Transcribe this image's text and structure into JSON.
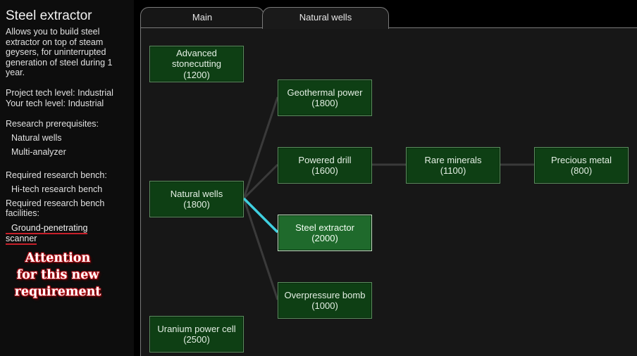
{
  "info": {
    "title": "Steel extractor",
    "description": "Allows you to build steel extractor on top of steam geysers, for uninterrupted generation of steel during 1 year.",
    "project_tech_level": "Project tech level: Industrial",
    "your_tech_level": "Your tech level: Industrial",
    "prereq_heading": "Research prerequisites:",
    "prerequisites": [
      "Natural wells",
      "Multi-analyzer"
    ],
    "bench_heading": "Required research bench:",
    "bench": "Hi-tech research bench",
    "facilities_heading_1": "Required research bench",
    "facilities_heading_2": "facilities:",
    "facility_line1": "Ground-penetrating",
    "facility_line2": "scanner"
  },
  "annotation": {
    "line1": "Attention",
    "line2": "for this new",
    "line3": "requirement",
    "color": "#c01018"
  },
  "tabs": [
    {
      "label": "Main"
    },
    {
      "label": "Natural wells"
    }
  ],
  "nodes": [
    {
      "name": "Advanced stonecutting",
      "cost": "(1200)"
    },
    {
      "name": "Geothermal power",
      "cost": "(1800)"
    },
    {
      "name": "Powered drill",
      "cost": "(1600)"
    },
    {
      "name": "Rare minerals",
      "cost": "(1100)"
    },
    {
      "name": "Precious metal",
      "cost": "(800)"
    },
    {
      "name": "Natural wells",
      "cost": "(1800)"
    },
    {
      "name": "Steel extractor",
      "cost": "(2000)"
    },
    {
      "name": "Overpressure bomb",
      "cost": "(1000)"
    },
    {
      "name": "Uranium power cell",
      "cost": "(2500)"
    }
  ],
  "colors": {
    "node_bg": "#0e3f14",
    "node_selected_bg": "#1f6a2c",
    "link": "#3a3a3a",
    "link_active": "#3fd0e0"
  }
}
